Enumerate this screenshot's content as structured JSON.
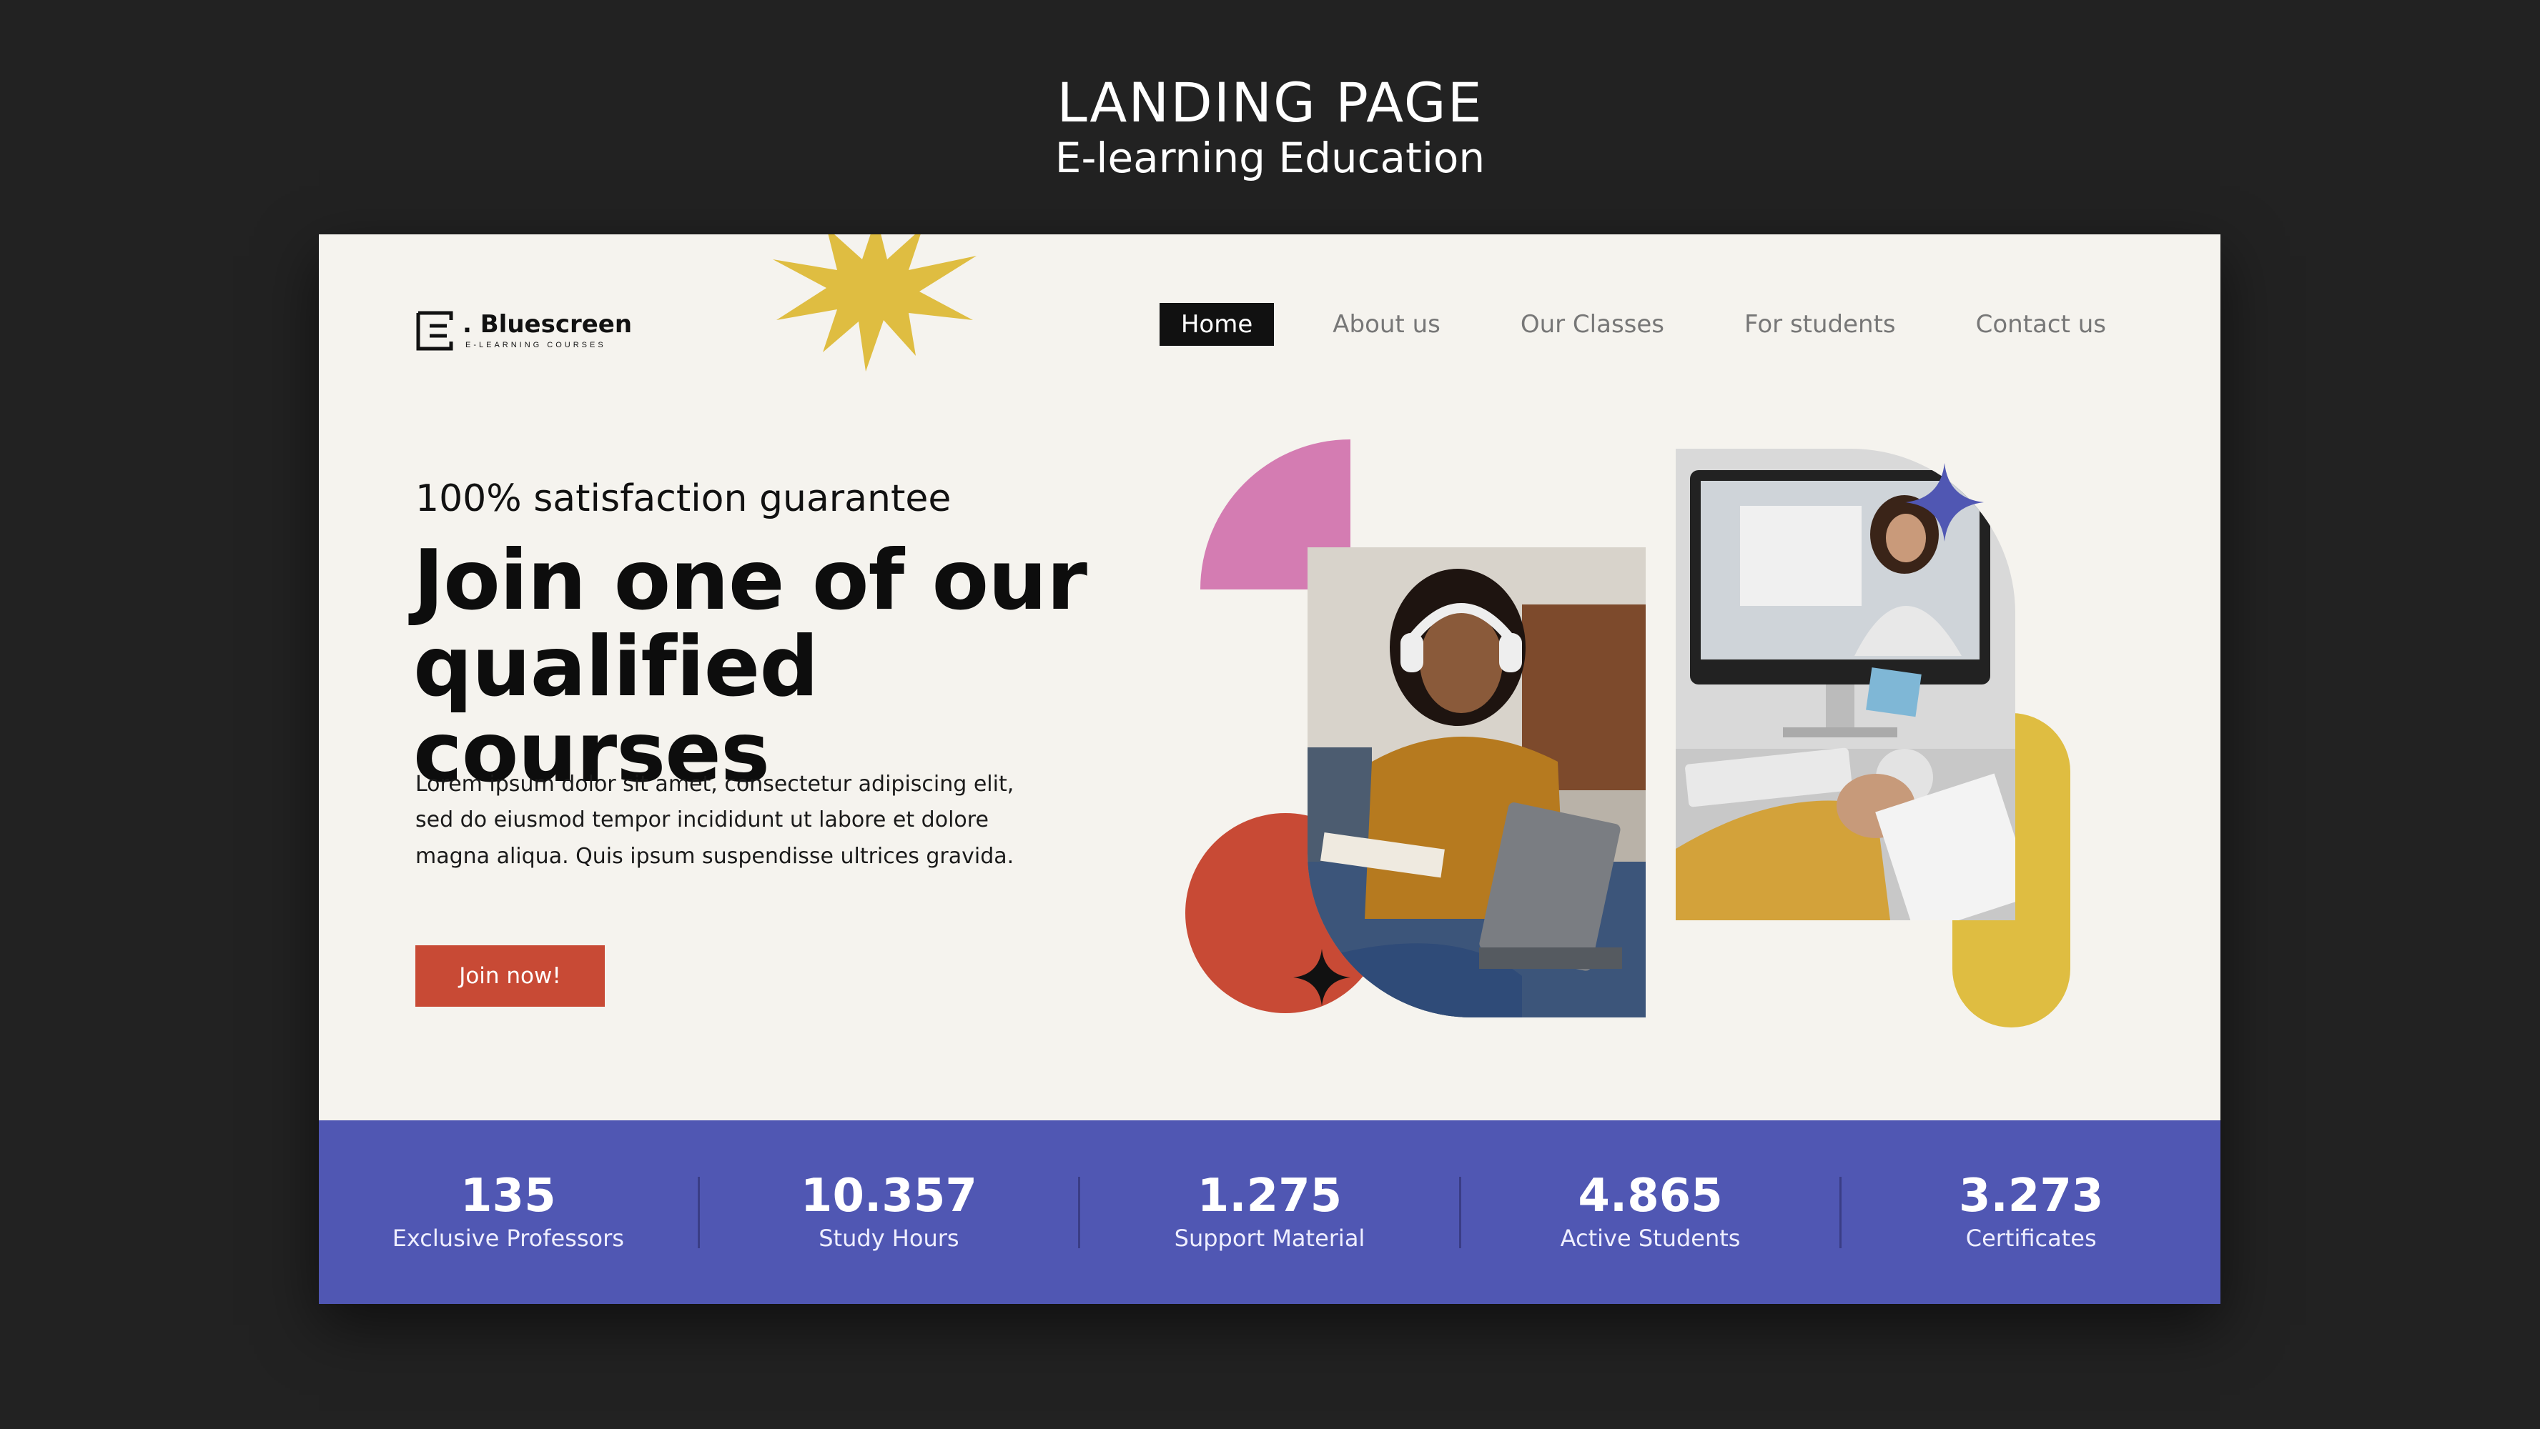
{
  "presentation": {
    "title": "LANDING PAGE",
    "subtitle": "E-learning Education"
  },
  "logo": {
    "name": ". Bluescreen",
    "tagline": "E-LEARNING COURSES"
  },
  "nav": {
    "items": [
      {
        "label": "Home",
        "active": true
      },
      {
        "label": "About us",
        "active": false
      },
      {
        "label": "Our Classes",
        "active": false
      },
      {
        "label": "For students",
        "active": false
      },
      {
        "label": "Contact us",
        "active": false
      }
    ]
  },
  "hero": {
    "eyebrow": "100% satisfaction guarantee",
    "title_line1": "Join one of our",
    "title_line2": "qualified courses",
    "body": "Lorem ipsum dolor sit amet, consectetur adipiscing elit, sed do eiusmod tempor incididunt ut labore et dolore magna aliqua. Quis ipsum suspendisse ultrices gravida.",
    "cta": "Join now!"
  },
  "stats": [
    {
      "value": "135",
      "label": "Exclusive Professors"
    },
    {
      "value": "10.357",
      "label": "Study Hours"
    },
    {
      "value": "1.275",
      "label": "Support Material"
    },
    {
      "value": "4.865",
      "label": "Active Students"
    },
    {
      "value": "3.273",
      "label": "Certificates"
    }
  ],
  "colors": {
    "background": "#222222",
    "card": "#f5f3ee",
    "accent_red": "#c84a35",
    "accent_pink": "#d47cb2",
    "accent_yellow": "#dfbd41",
    "accent_blue": "#5057b3",
    "dark": "#111111"
  }
}
